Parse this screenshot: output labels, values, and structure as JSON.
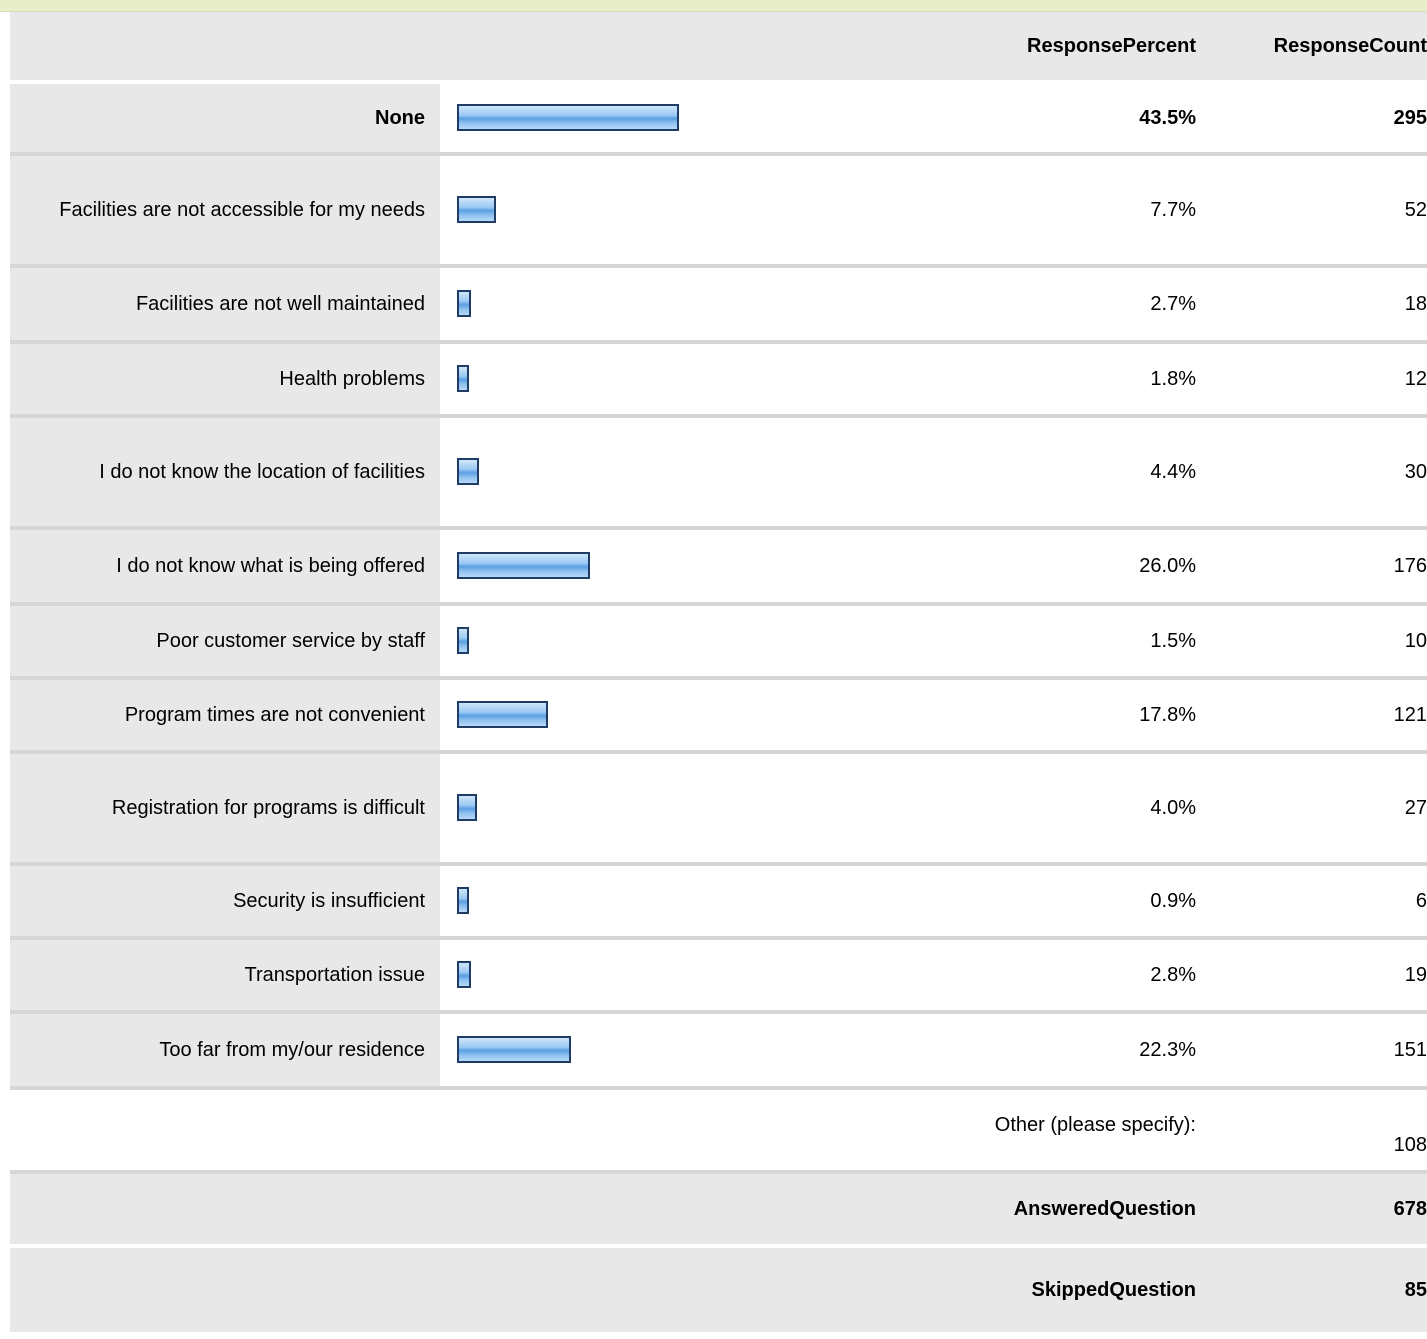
{
  "header": {
    "percent_label": "ResponsePercent",
    "count_label": "ResponseCount"
  },
  "rows": [
    {
      "label": "None",
      "percent": "43.5%",
      "count": "295",
      "value": 43.5
    },
    {
      "label": "Facilities are not accessible for my needs",
      "percent": "7.7%",
      "count": "52",
      "value": 7.7
    },
    {
      "label": "Facilities are not well maintained",
      "percent": "2.7%",
      "count": "18",
      "value": 2.7
    },
    {
      "label": "Health problems",
      "percent": "1.8%",
      "count": "12",
      "value": 1.8
    },
    {
      "label": "I do not know the location of facilities",
      "percent": "4.4%",
      "count": "30",
      "value": 4.4
    },
    {
      "label": "I do not know what is being offered",
      "percent": "26.0%",
      "count": "176",
      "value": 26.0
    },
    {
      "label": "Poor customer service by staff",
      "percent": "1.5%",
      "count": "10",
      "value": 1.5
    },
    {
      "label": "Program times are not convenient",
      "percent": "17.8%",
      "count": "121",
      "value": 17.8
    },
    {
      "label": "Registration for programs is difficult",
      "percent": "4.0%",
      "count": "27",
      "value": 4.0
    },
    {
      "label": "Security is insufficient",
      "percent": "0.9%",
      "count": "6",
      "value": 0.9
    },
    {
      "label": "Transportation issue",
      "percent": "2.8%",
      "count": "19",
      "value": 2.8
    },
    {
      "label": "Too far from my/our residence",
      "percent": "22.3%",
      "count": "151",
      "value": 22.3
    }
  ],
  "other": {
    "label": "Other (please specify):",
    "count": "108"
  },
  "summary": {
    "answered_label": "AnsweredQuestion",
    "answered_count": "678",
    "skipped_label": "SkippedQuestion",
    "skipped_count": "85"
  },
  "colors": {
    "label_bg": "#e8e8e8",
    "bar_border": "#1f3d64",
    "bar_fill": "#6aa8e8",
    "row_divider": "#d6d6d6",
    "top_band": "#e8eec9"
  }
}
